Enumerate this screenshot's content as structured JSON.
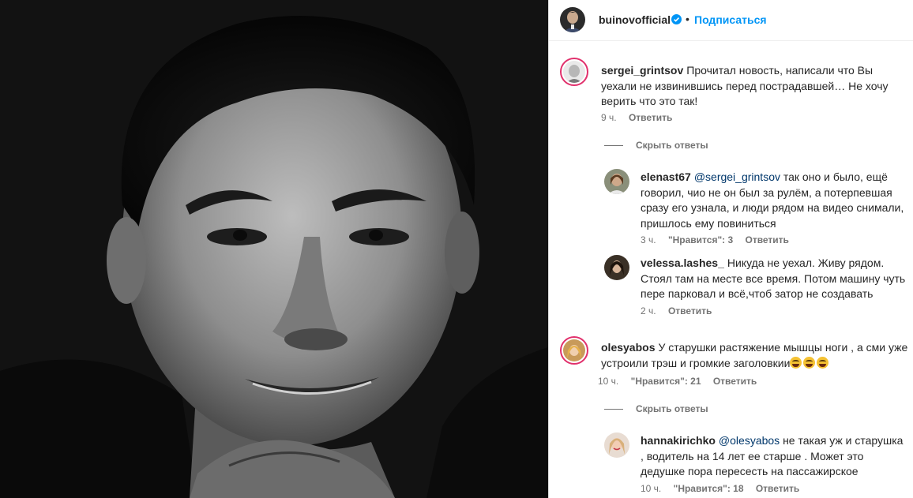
{
  "post": {
    "photo_alt": "Black and white portrait of a smiling man"
  },
  "header": {
    "username": "buinovofficial",
    "dot": "•",
    "follow_label": "Подписаться"
  },
  "comments": [
    {
      "username": "sergei_grintsov",
      "text": "Прочитал новость, написали что Вы уехали не извинившись перед пострадавшей… Не хочу верить что это так!",
      "time": "9 ч.",
      "reply_label": "Ответить",
      "hide_replies_label": "Скрыть ответы",
      "replies": [
        {
          "username": "elenast67",
          "mention": "@sergei_grintsov",
          "text": " так оно и было, ещё говорил, чио не он был за рулём, а потерпевшая сразу его узнала, и люди рядом на видео снимали, пришлось ему повиниться",
          "time": "3 ч.",
          "likes": "\"Нравится\": 3",
          "reply_label": "Ответить"
        },
        {
          "username": "velessa.lashes_",
          "text": "Никуда не уехал. Живу рядом. Стоял там на месте все время. Потом машину чуть пере парковал и всё,чтоб затор не создавать",
          "time": "2 ч.",
          "reply_label": "Ответить"
        }
      ]
    },
    {
      "username": "olesyabos",
      "text": "У старушки растяжение мышцы ноги , а сми уже устроили трэш и громкие заголовкии",
      "emoji": [
        "grinning-sweat-emoji",
        "grinning-sweat-emoji",
        "grinning-sweat-emoji"
      ],
      "time": "10 ч.",
      "likes": "\"Нравится\": 21",
      "reply_label": "Ответить",
      "hide_replies_label": "Скрыть ответы",
      "replies": [
        {
          "username": "hannakirichko",
          "mention": "@olesyabos",
          "text": " не такая уж и старушка , водитель на 14 лет ее старше . Может это дедушке пора пересесть на пассажирское",
          "time": "10 ч.",
          "likes": "\"Нравится\": 18",
          "reply_label": "Ответить"
        }
      ]
    }
  ],
  "colors": {
    "link_blue": "#0095f6",
    "mention_blue": "#00376b",
    "meta_gray": "#737373",
    "verified_blue": "#0095f6"
  }
}
